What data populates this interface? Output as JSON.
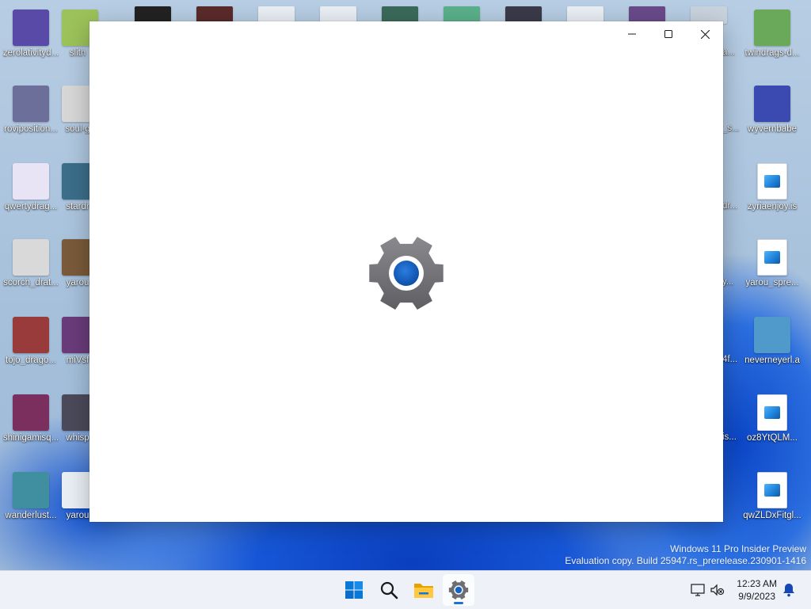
{
  "desktop": {
    "left_icons": [
      {
        "label": "zerolativityd...",
        "color": "#5a4aa8"
      },
      {
        "label": "roviposition...",
        "color": "#6b6f9a"
      },
      {
        "label": "qwertydrag...",
        "color": "#e9e4f5"
      },
      {
        "label": "scorch_drat...",
        "color": "#d9d9d9"
      },
      {
        "label": "tojo_drago...",
        "color": "#9a3b3b"
      },
      {
        "label": "shinigamisq...",
        "color": "#7a2f5e"
      },
      {
        "label": "wanderlust...",
        "color": "#3f8fa0"
      }
    ],
    "second_col_icons": [
      {
        "label": "slith",
        "color": "#9cc25a"
      },
      {
        "label": "soul-g",
        "color": "#d7d7d7"
      },
      {
        "label": "stardr",
        "color": "#3b6e8a"
      },
      {
        "label": "yarou",
        "color": "#7a5a3a"
      },
      {
        "label": "miVsf",
        "color": "#6a3b7a"
      },
      {
        "label": "whisp",
        "color": "#4a4a5a"
      },
      {
        "label": "yarou",
        "color": "#e9eef4"
      }
    ],
    "right_icons": [
      {
        "label": "twindrags-d...",
        "color": "#6aa85a",
        "type": "image"
      },
      {
        "label": "wyvernbabe",
        "color": "#3a4ab0",
        "type": "image"
      },
      {
        "label": "zyriaenjoy.is",
        "color": "#ffffff",
        "type": "file"
      },
      {
        "label": "yarou_spre...",
        "color": "#ffffff",
        "type": "file"
      },
      {
        "label": "neverneyerl.a",
        "color": "#4f9acb",
        "type": "image"
      },
      {
        "label": "oz8YtQLM...",
        "color": "#ffffff",
        "type": "file"
      },
      {
        "label": "qwZLDxFitgl...",
        "color": "#ffffff",
        "type": "file"
      }
    ],
    "right_partial_labels": [
      "a...",
      "_s...",
      "dr...",
      "y...",
      "4f...",
      "is...",
      ""
    ],
    "watermark": {
      "line1": "Windows 11 Pro Insider Preview",
      "line2": "Evaluation copy. Build 25947.rs_prerelease.230901-1416"
    }
  },
  "window": {
    "app": "Settings",
    "icon": "settings-gear-icon",
    "caption_buttons": {
      "minimize": "minimize-icon",
      "maximize": "maximize-icon",
      "close": "close-icon"
    }
  },
  "taskbar": {
    "buttons": [
      {
        "name": "start-button",
        "icon": "windows-logo-icon"
      },
      {
        "name": "search-button",
        "icon": "search-icon"
      },
      {
        "name": "file-explorer-button",
        "icon": "folder-icon"
      },
      {
        "name": "settings-taskbar-button",
        "icon": "settings-gear-icon",
        "active": true
      }
    ],
    "tray": {
      "time": "12:23 AM",
      "date": "9/9/2023"
    }
  },
  "colors": {
    "accent": "#1a73d9",
    "gear_gray": "#6e6e72",
    "gear_blue": "#1565c0"
  }
}
